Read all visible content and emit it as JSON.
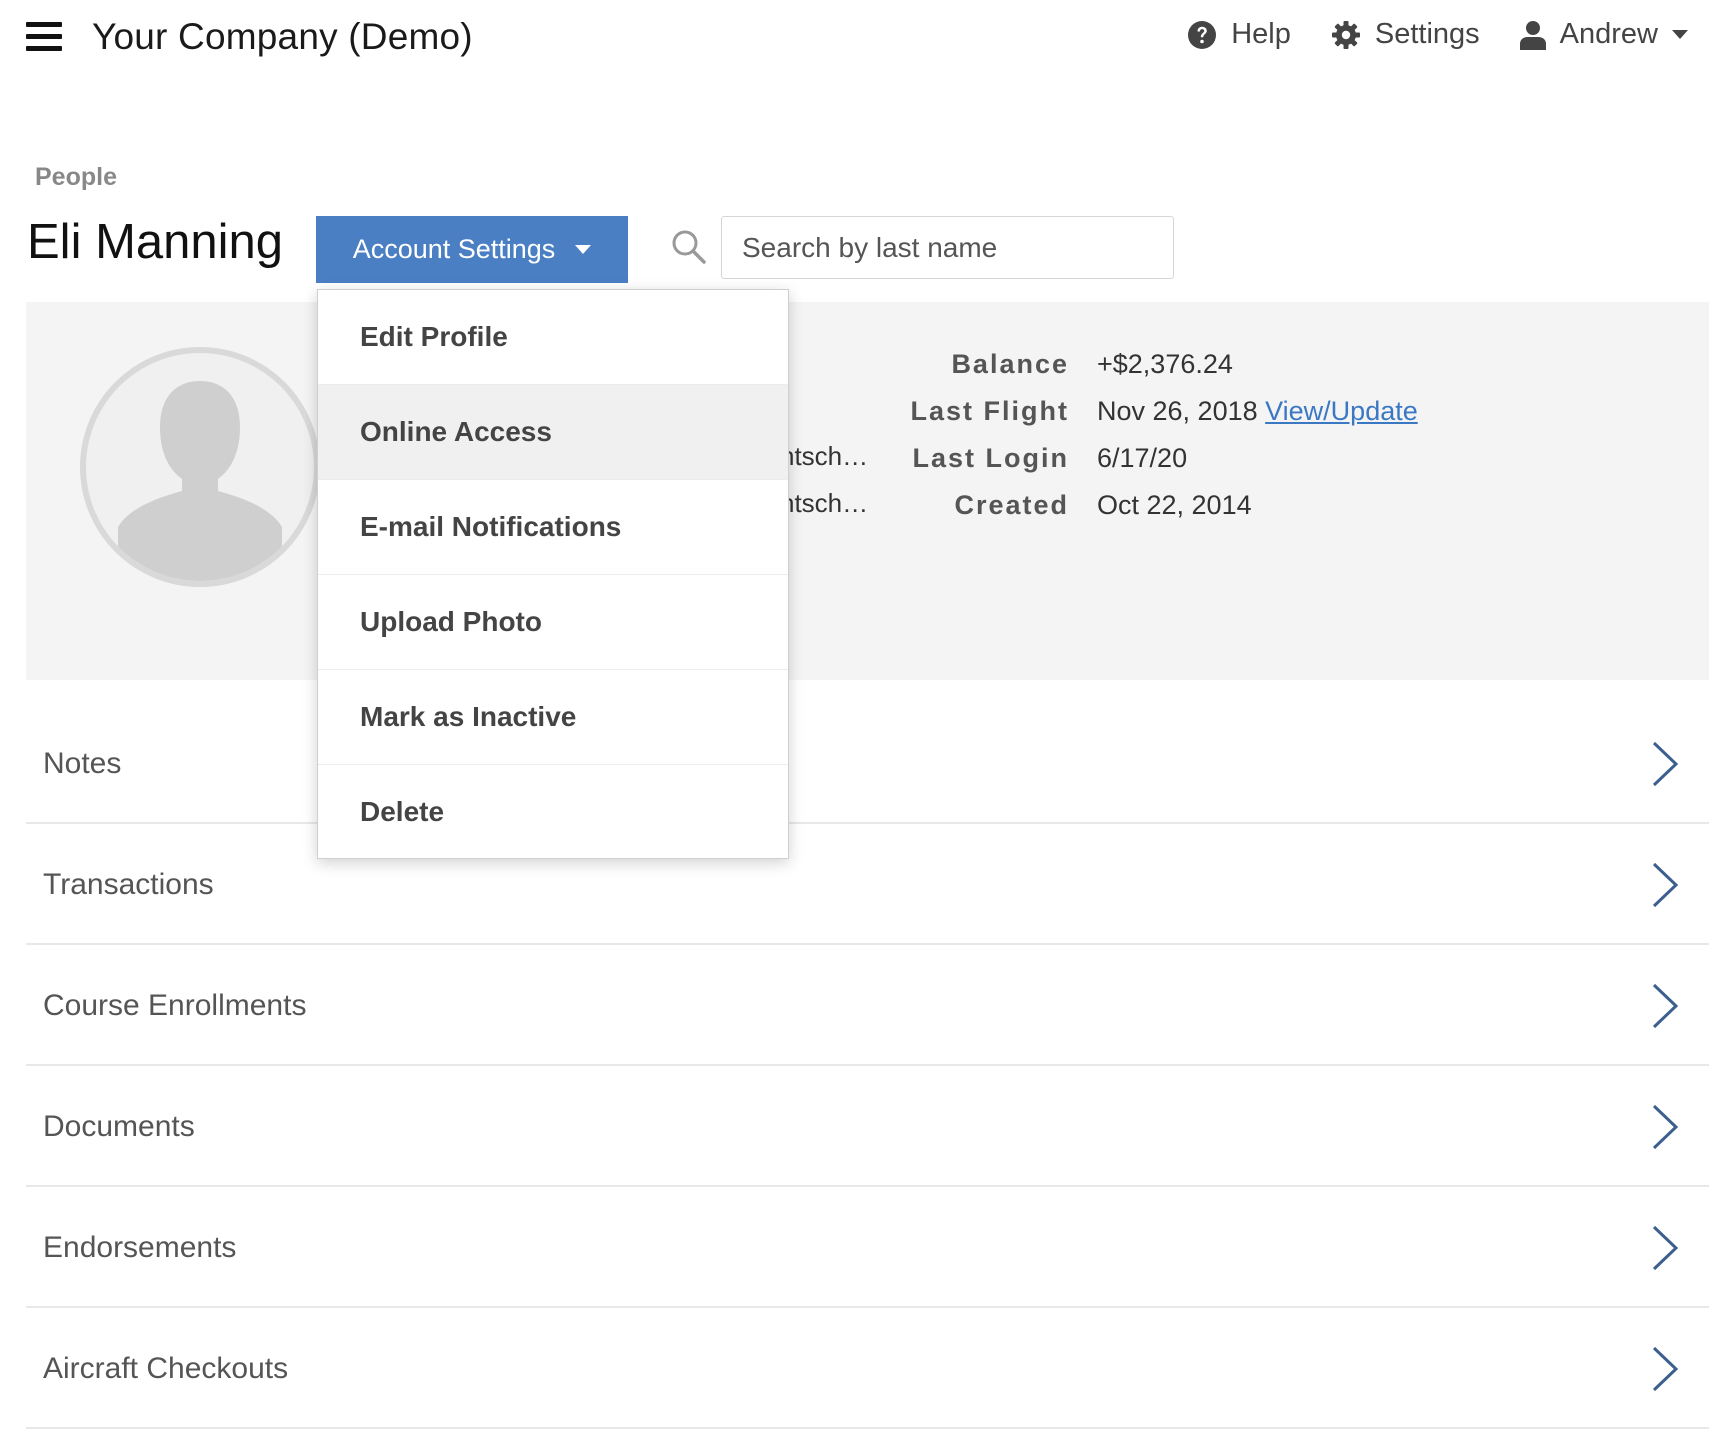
{
  "header": {
    "company": "Your Company (Demo)",
    "help_label": "Help",
    "settings_label": "Settings",
    "user_label": "Andrew"
  },
  "breadcrumb": "People",
  "page_title": "Eli Manning",
  "account_settings_label": "Account Settings",
  "search": {
    "placeholder": "Search by last name",
    "value": ""
  },
  "profile": {
    "truncated": [
      "htsch…",
      "htsch…"
    ],
    "stats": [
      {
        "label": "Balance",
        "value": "+$2,376.24"
      },
      {
        "label": "Last Flight",
        "value": "Nov 26, 2018",
        "link": "View/Update"
      },
      {
        "label": "Last Login",
        "value": "6/17/20"
      },
      {
        "label": "Created",
        "value": "Oct 22, 2014"
      }
    ]
  },
  "menu": {
    "items": [
      "Edit Profile",
      "Online Access",
      "E-mail Notifications",
      "Upload Photo",
      "Mark as Inactive",
      "Delete"
    ],
    "active_index": 1
  },
  "sections": [
    "Notes",
    "Transactions",
    "Course Enrollments",
    "Documents",
    "Endorsements",
    "Aircraft Checkouts"
  ],
  "colors": {
    "accent": "#4a7fc4",
    "link": "#3b78c4",
    "panel_bg": "#f4f4f4",
    "chevron": "#3c5f8f"
  }
}
